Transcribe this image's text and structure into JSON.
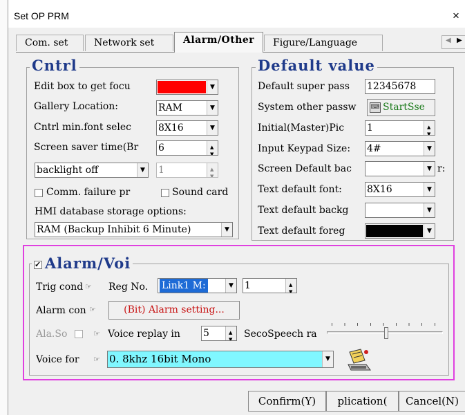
{
  "window": {
    "title": "Set OP PRM",
    "close_glyph": "×"
  },
  "tabs": [
    {
      "label": "Com. set"
    },
    {
      "label": "Network set"
    },
    {
      "label": "Alarm/Other"
    },
    {
      "label": "Figure/Language"
    }
  ],
  "tab_nav": {
    "left": "◀",
    "right": "▶"
  },
  "cntrl": {
    "legend": "Cntrl",
    "edit_focus_label": "Edit box to get focu",
    "edit_focus_color": "#ff0000",
    "gallery_label": "Gallery Location:",
    "gallery_value": "RAM",
    "minfont_label": "Cntrl min.font selec",
    "minfont_value": "8X16",
    "saver_label": "Screen saver time(Br",
    "saver_value": "6",
    "backlight_value": "backlight off",
    "backlight_num": "1",
    "comm_failure_label": "Comm. failure pr",
    "sound_card_label": "Sound card",
    "db_label": "HMI database storage options:",
    "db_value": "RAM (Backup Inhibit 6 Minute)"
  },
  "defaults": {
    "legend": "Default value",
    "super_pass_label": "Default super pass",
    "super_pass_value": "12345678",
    "other_pass_label": "System other passw",
    "startsse_label": "StartSse",
    "initial_pic_label": "Initial(Master)Pic",
    "initial_pic_value": "1",
    "keypad_label": "Input Keypad Size:",
    "keypad_value": "4#",
    "screen_bg_label": "Screen Default bac",
    "screen_bg_suffix": "r:",
    "text_font_label": "Text default font:",
    "text_font_value": "8X16",
    "text_bg_label": "Text default backg",
    "text_fg_label": "Text default foreg",
    "text_fg_color": "#000000"
  },
  "alarm": {
    "legend": "Alarm/Voi",
    "trig_label": "Trig cond",
    "reg_no_label": "Reg No.",
    "link_value": "Link1 M:",
    "reg_num_value": "1",
    "alarm_cond_label": "Alarm con",
    "alarm_setting_button": "(Bit) Alarm setting...",
    "ala_sound_label": "Ala.So",
    "voice_replay_label": "Voice replay in",
    "voice_replay_value": "5",
    "speech_label": "SecoSpeech ra",
    "voice_format_label": "Voice for",
    "voice_format_value": "0. 8khz  16bit Mono",
    "highlight_color": "#e040e0"
  },
  "footer": {
    "confirm_label": "Confirm(Y)",
    "apply_label": "plication(",
    "cancel_label": "Cancel(N)"
  }
}
